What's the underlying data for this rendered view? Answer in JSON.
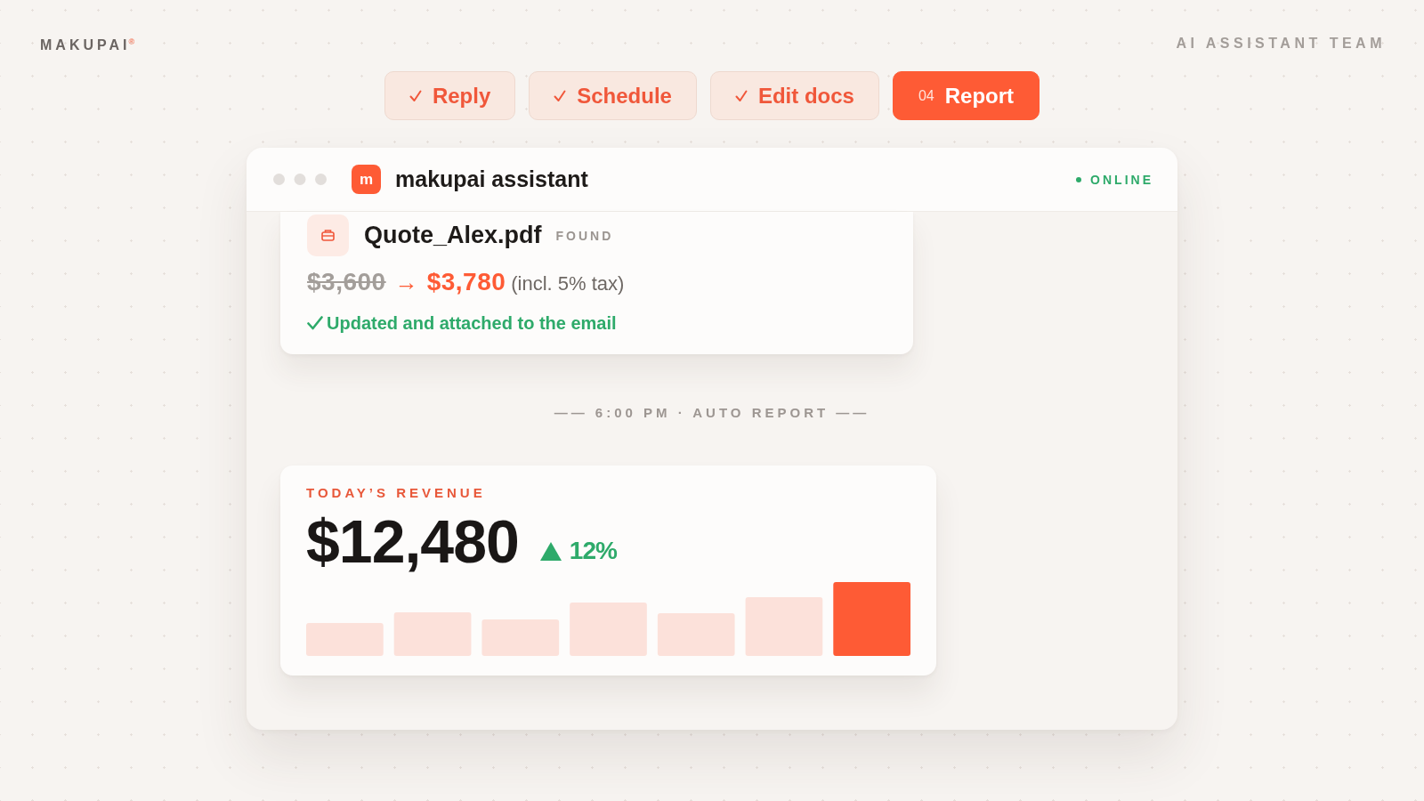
{
  "brand": "MAKUPAI$^{®}$",
  "tagline": "AI ASSISTANT TEAM",
  "tabs": [
    {
      "label": "Reply",
      "done": true,
      "selected": false
    },
    {
      "label": "Schedule",
      "done": true,
      "selected": false
    },
    {
      "label": "Edit docs",
      "done": true,
      "selected": false
    },
    {
      "label": "Report",
      "number": "04",
      "done": false,
      "selected": true
    }
  ],
  "window": {
    "title": "makupai assistant",
    "app_icon": "m",
    "status": "ONLINE"
  },
  "messages": [
    {
      "kind": "file",
      "filename": "Quote_Alex.pdf",
      "badge": "FOUND",
      "old_price": "$3,600",
      "arrow": "→",
      "new_price": "$3,780",
      "note": "(incl. 5% tax)",
      "result": "Updated and attached to the email"
    },
    {
      "kind": "divider",
      "text": "—— 6:00 PM · AUTO REPORT ——"
    },
    {
      "kind": "revenue",
      "label": "TODAY’S REVENUE",
      "amount": "$12,480",
      "rising": true,
      "change": "12%"
    }
  ]
}
